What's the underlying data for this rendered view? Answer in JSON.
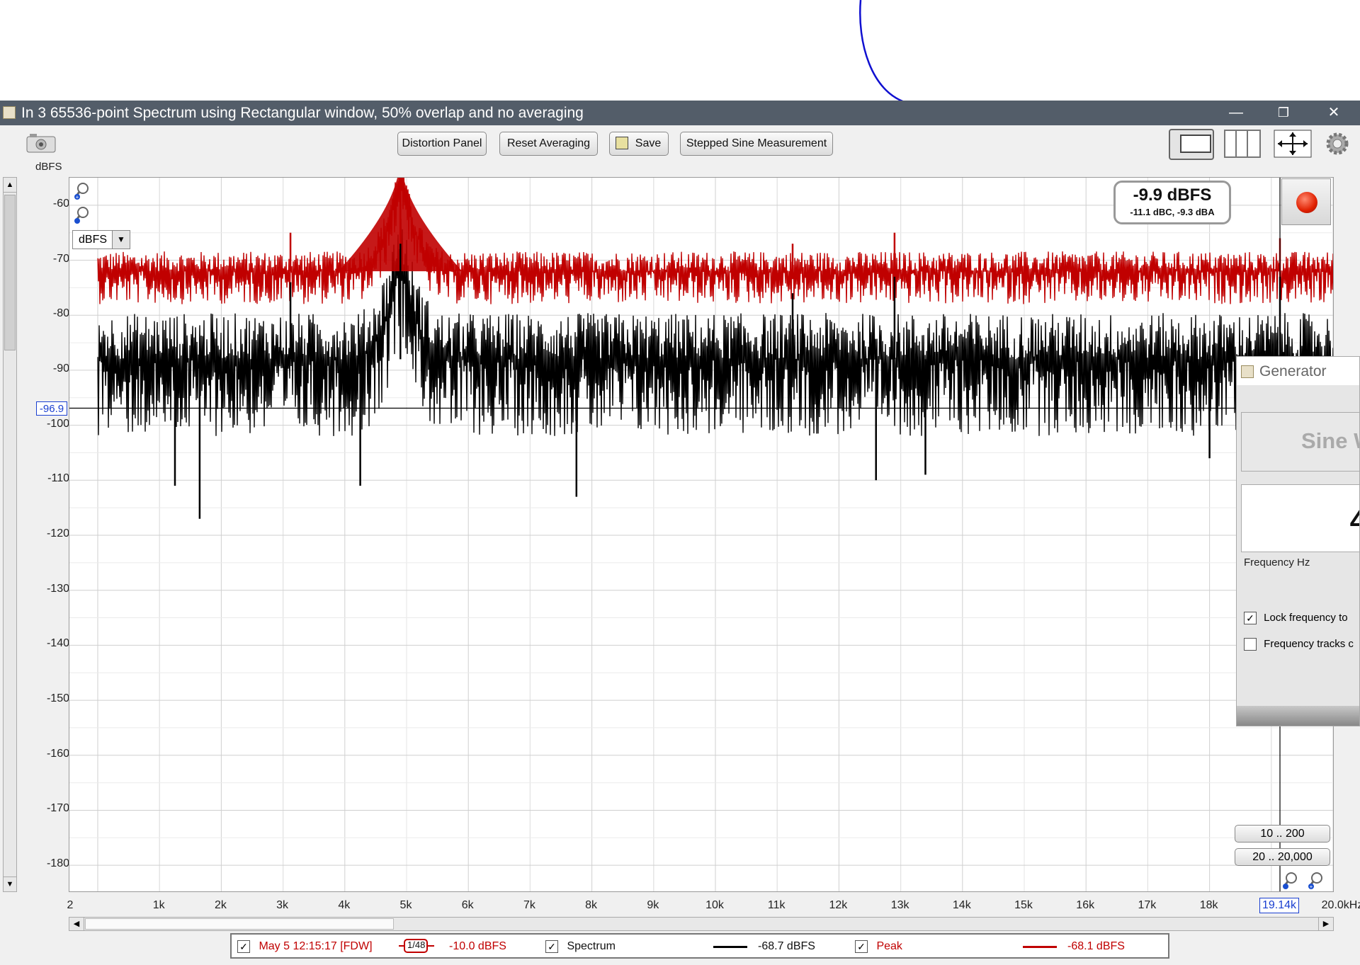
{
  "window": {
    "title": "In 3 65536-point Spectrum using Rectangular window, 50% overlap and no averaging",
    "minimize": "—",
    "restore": "❐",
    "close": "✕"
  },
  "toolbar": {
    "distortion_panel": "Distortion Panel",
    "reset_averaging": "Reset Averaging",
    "save": "Save",
    "stepped_sine": "Stepped Sine Measurement"
  },
  "chart_data": {
    "type": "line",
    "ylabel": "dBFS",
    "xlabel": "",
    "y_ticks": [
      "-60",
      "-70",
      "-80",
      "-90",
      "-100",
      "-110",
      "-120",
      "-130",
      "-140",
      "-150",
      "-160",
      "-170",
      "-180"
    ],
    "x_ticks": [
      "2",
      "1k",
      "2k",
      "3k",
      "4k",
      "5k",
      "6k",
      "7k",
      "8k",
      "9k",
      "10k",
      "11k",
      "12k",
      "13k",
      "14k",
      "15k",
      "16k",
      "17k",
      "18k",
      "20.0kHz"
    ],
    "xlim": [
      0,
      20000
    ],
    "ylim": [
      -185,
      -55
    ],
    "grid": true,
    "y_cursor": {
      "label": "-96.9",
      "value": -96.9
    },
    "x_cursor": {
      "label": "19.14k",
      "value": 19140
    },
    "unit_selector": "dBFS",
    "series": [
      {
        "name": "Peak",
        "color": "#c00000",
        "noise_floor": -72,
        "peaks": [
          {
            "x": 3120,
            "y": -65
          },
          {
            "x": 4900,
            "y": -55
          },
          {
            "x": 11250,
            "y": -67
          },
          {
            "x": 12900,
            "y": -65
          },
          {
            "x": 19140,
            "y": -66
          }
        ]
      },
      {
        "name": "Spectrum",
        "color": "#000000",
        "noise_floor": -88,
        "peaks": [
          {
            "x": 3120,
            "y": -74
          },
          {
            "x": 4900,
            "y": -67
          },
          {
            "x": 11250,
            "y": -76
          },
          {
            "x": 12900,
            "y": -73
          },
          {
            "x": 19140,
            "y": -73
          }
        ],
        "dips": [
          {
            "x": 1250,
            "y": -111
          },
          {
            "x": 1650,
            "y": -117
          },
          {
            "x": 4250,
            "y": -111
          },
          {
            "x": 7750,
            "y": -113
          },
          {
            "x": 12600,
            "y": -110
          },
          {
            "x": 13400,
            "y": -109
          },
          {
            "x": 18000,
            "y": -106
          }
        ]
      }
    ]
  },
  "level_meter": {
    "value": "-9.9 dBFS",
    "weighted": "-11.1 dBC, -9.3 dBA"
  },
  "generator": {
    "title": "Generator",
    "signal": "Sine W",
    "frequency_digit": "4",
    "frequency_label": "Frequency Hz",
    "lock_label": "Lock frequency to",
    "tracks_label": "Frequency tracks c"
  },
  "ranges": {
    "r1": "10 .. 200",
    "r2": "20 .. 20,000"
  },
  "legend": {
    "measurement": "May 5 12:15:17 [FDW]",
    "smoothing": "1/48",
    "measurement_level": "-10.0 dBFS",
    "spectrum_label": "Spectrum",
    "spectrum_level": "-68.7 dBFS",
    "peak_label": "Peak",
    "peak_level": "-68.1 dBFS"
  }
}
